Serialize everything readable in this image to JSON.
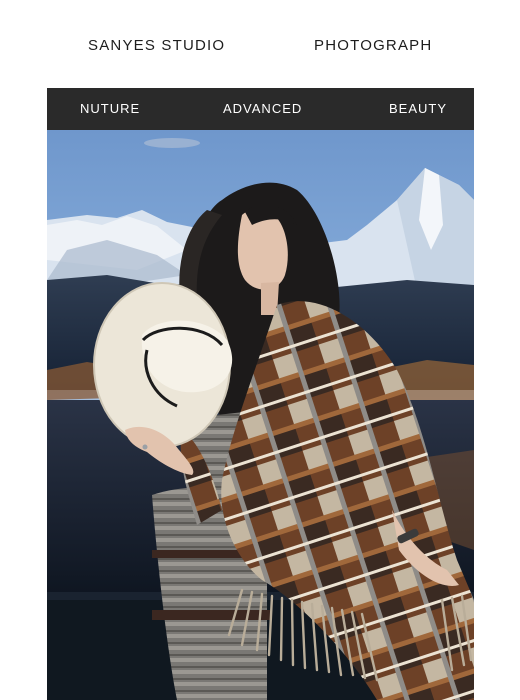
{
  "header": {
    "brand_left": "SANYES STUDIO",
    "brand_right": "PHOTOGRAPH"
  },
  "nav": {
    "items": [
      {
        "label": "NUTURE"
      },
      {
        "label": "ADVANCED"
      },
      {
        "label": "BEAUTY"
      }
    ]
  },
  "colors": {
    "nav_bg": "#2a2a2a",
    "brand_text": "#1d1d1d",
    "sky": "#7fa4d3",
    "mountains": "#dfe7f1",
    "shawl_brown": "#7a4a2a",
    "hat": "#efe9dc"
  }
}
